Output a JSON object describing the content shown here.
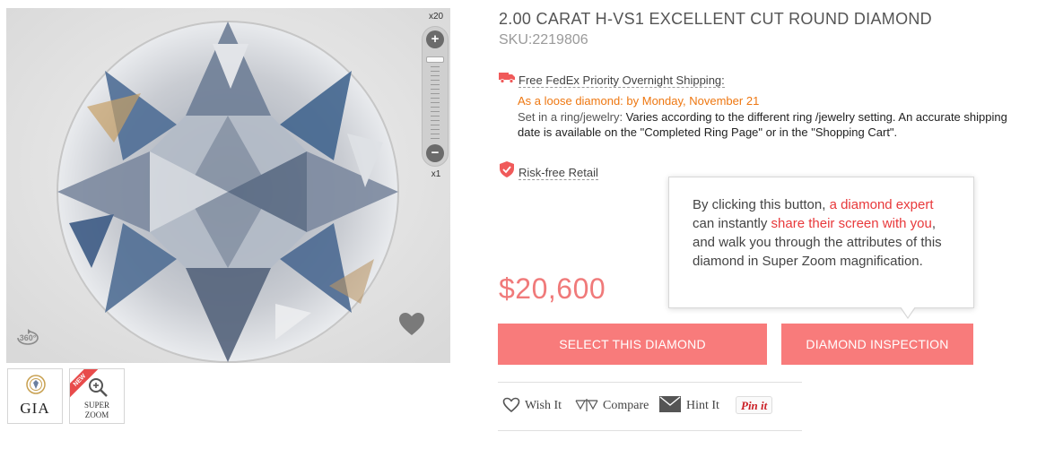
{
  "viewer": {
    "zoom_max_label": "x20",
    "zoom_min_label": "x1",
    "zoom_plus": "+",
    "zoom_minus": "−",
    "rotate_icon": "360-icon",
    "favorite_icon": "heart-icon",
    "rotate_label": "360°"
  },
  "thumbnails": {
    "gia_label": "GIA",
    "new_badge": "NEW",
    "super_zoom_line1": "SUPER",
    "super_zoom_line2": "ZOOM"
  },
  "product": {
    "title": "2.00 CARAT H-VS1 EXCELLENT CUT ROUND DIAMOND",
    "sku": "SKU:2219806",
    "price": "$20,600"
  },
  "shipping": {
    "title": "Free FedEx Priority Overnight Shipping:",
    "loose_label": "As a loose diamond: by Monday, November 21",
    "setin_label": "Set in a ring/jewelry:",
    "setin_text": " Varies according to the different ring /jewelry setting. An accurate shipping date is available on the \"Completed Ring Page\" or in the \"Shopping Cart\"."
  },
  "risk": {
    "label": "Risk-free Retail"
  },
  "tooltip": {
    "part1": "By clicking this button, ",
    "part2": "a diamond expert",
    "part3": " can instantly ",
    "part4": "share their screen with you",
    "part5": ", and walk you through the attributes of this diamond in Super Zoom magnification."
  },
  "buttons": {
    "select": "SELECT THIS DIAMOND",
    "inspect": "DIAMOND INSPECTION"
  },
  "actions": {
    "wish": "Wish It",
    "compare": "Compare",
    "hint": "Hint It",
    "pin": "Pin it"
  },
  "colors": {
    "accent": "#f87b7b",
    "price": "#f07a7a",
    "shipping_highlight": "#ee7711",
    "tooltip_highlight": "#e8393b",
    "truck_icon": "#f05a5a"
  }
}
